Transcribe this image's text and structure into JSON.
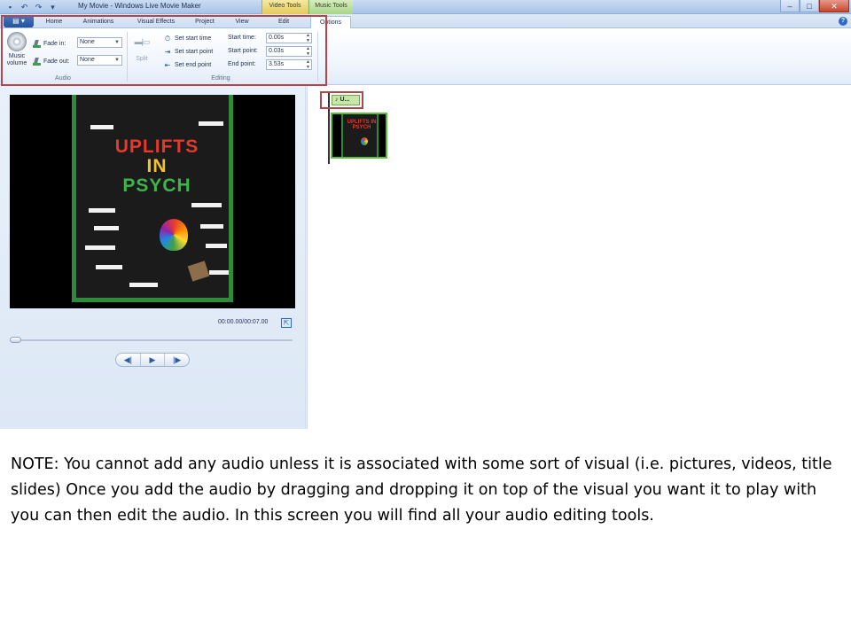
{
  "window": {
    "title": "My Movie - Windows Live Movie Maker",
    "context_tabs": {
      "video_tools": "Video Tools",
      "music_tools": "Music Tools"
    },
    "controls": {
      "minimize": "–",
      "maximize": "□",
      "close": "✕"
    }
  },
  "quick_access": {
    "icons": [
      "save-icon",
      "undo-icon",
      "redo-icon",
      "dropdown-icon"
    ],
    "glyphs": [
      "▪",
      "↶",
      "↷",
      "▾"
    ]
  },
  "tabs": [
    {
      "label": "Home"
    },
    {
      "label": "Animations"
    },
    {
      "label": "Visual Effects"
    },
    {
      "label": "Project"
    },
    {
      "label": "View"
    },
    {
      "label": "Edit"
    },
    {
      "label": "Options"
    }
  ],
  "active_tab": "Options",
  "app_menu_glyph": "▤ ▾",
  "help_glyph": "?",
  "ribbon": {
    "audio": {
      "group_label": "Audio",
      "music_volume_label": "Music volume",
      "fade_in_label": "Fade in:",
      "fade_in_value": "None",
      "fade_out_label": "Fade out:",
      "fade_out_value": "None"
    },
    "editing": {
      "group_label": "Editing",
      "split_label": "Split",
      "set_start_time": "Set start time",
      "set_start_point": "Set start point",
      "set_end_point": "Set end point",
      "start_time_label": "Start time:",
      "start_time_value": "0.00s",
      "start_point_label": "Start point:",
      "start_point_value": "0.03s",
      "end_point_label": "End point:",
      "end_point_value": "3.53s"
    }
  },
  "preview": {
    "headline_lines": [
      "UPLIFTS",
      "IN",
      "PSYCH"
    ],
    "timecode": "00:00.00/00:07.00",
    "transport": {
      "prev": "◀|",
      "play": "▶",
      "next": "|▶"
    },
    "fullscreen_glyph": "⇱"
  },
  "storyboard": {
    "music_label": "♪ U...",
    "clip_title": "UPLIFTS IN PSYCH"
  },
  "note": "NOTE: You cannot add any audio unless it is associated with some sort of visual (i.e. pictures, videos, title slides) Once you add the audio by dragging and dropping it on top of the visual you want it to play with you can then edit the audio. In this screen you will find all your audio editing tools.",
  "colors": {
    "highlight": "#b3464c",
    "board_border": "#2e8b3a",
    "music_bar": "#c7e7a8",
    "video_tools_tab": "#e2c95a",
    "music_tools_tab": "#a9d58a"
  }
}
